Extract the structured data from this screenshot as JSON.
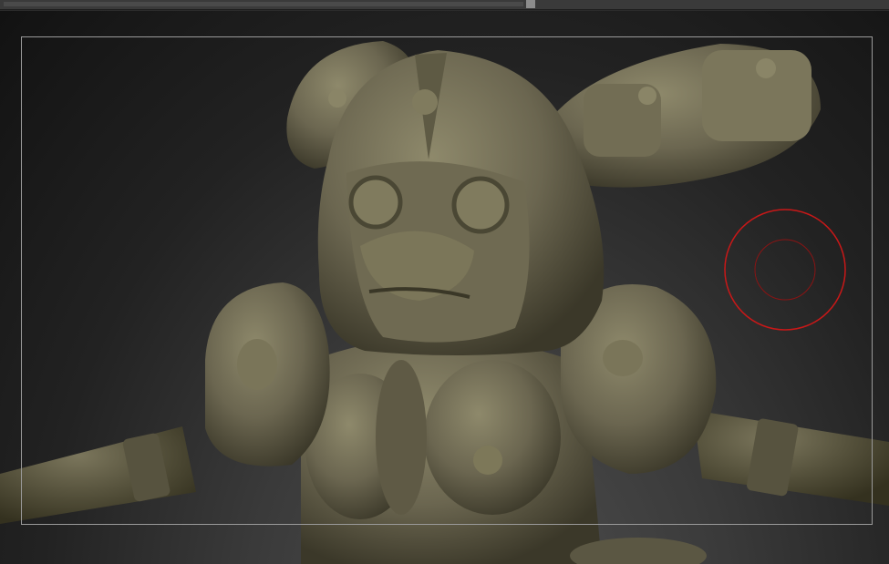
{
  "app": {
    "name": ""
  },
  "viewport": {
    "background": "#1c1c1c",
    "model_color": "#6b6650",
    "model_shadow": "#3a372a",
    "model_highlight": "#8c8769",
    "brush_color": "#c81818"
  },
  "icons": {
    "brush_cursor": "circle-brush-icon"
  }
}
